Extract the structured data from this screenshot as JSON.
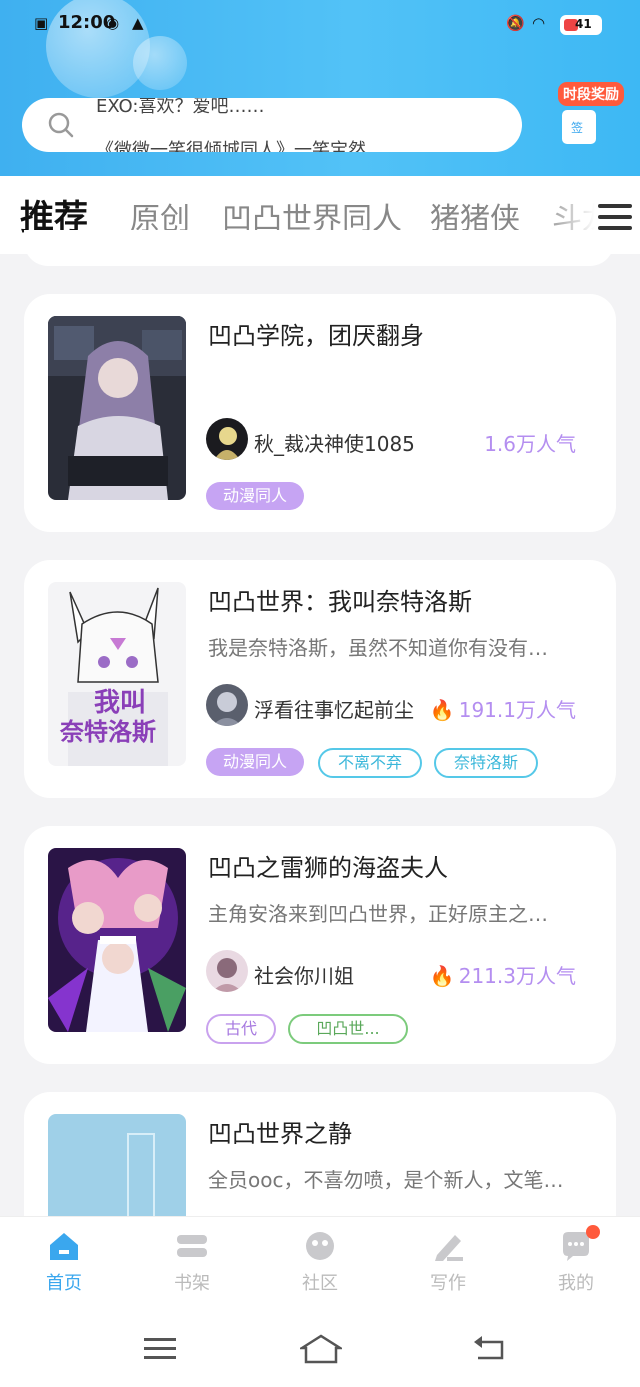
{
  "status_bar": {
    "time": "12:00",
    "battery": "41"
  },
  "search": {
    "hint_top": "EXO:喜欢？爱吧……",
    "hint_bottom": "《微微一笑很倾城同人》一笑宝然"
  },
  "reward": {
    "label": "时段奖励",
    "icon_text": "签"
  },
  "tabs": [
    {
      "label": "推荐"
    },
    {
      "label": "原创"
    },
    {
      "label": "凹凸世界同人"
    },
    {
      "label": "猪猪侠"
    },
    {
      "label": "斗龙"
    }
  ],
  "cards": [
    {
      "title": "凹凸学院，团厌翻身",
      "description": "",
      "author": "秋_裁决神使1085",
      "popularity": "1.6万人气",
      "tags": [
        "动漫同人"
      ]
    },
    {
      "title": "凹凸世界：我叫奈特洛斯",
      "description": "我是奈特洛斯，虽然不知道你有没有…",
      "author": "浮看往事忆起前尘",
      "popularity": "191.1万人气",
      "tags": [
        "动漫同人",
        "不离不弃",
        "奈特洛斯"
      ],
      "cover_text_1": "我叫",
      "cover_text_2": "奈特洛斯"
    },
    {
      "title": "凹凸之雷狮的海盗夫人",
      "description": "主角安洛来到凹凸世界，正好原主之…",
      "author": "社会你川姐",
      "popularity": "211.3万人气",
      "tags": [
        "古代",
        "凹凸世..."
      ]
    },
    {
      "title": "凹凸世界之静",
      "description": "全员ooc，不喜勿喷，是个新人，文笔…"
    }
  ],
  "bottom_nav": [
    {
      "label": "首页"
    },
    {
      "label": "书架"
    },
    {
      "label": "社区"
    },
    {
      "label": "写作"
    },
    {
      "label": "我的"
    }
  ],
  "colors": {
    "header_blue": "#4bbcf5",
    "accent_purple": "#b48ef0",
    "nav_active": "#3aa7ee",
    "badge_red": "#ff5a3c"
  }
}
